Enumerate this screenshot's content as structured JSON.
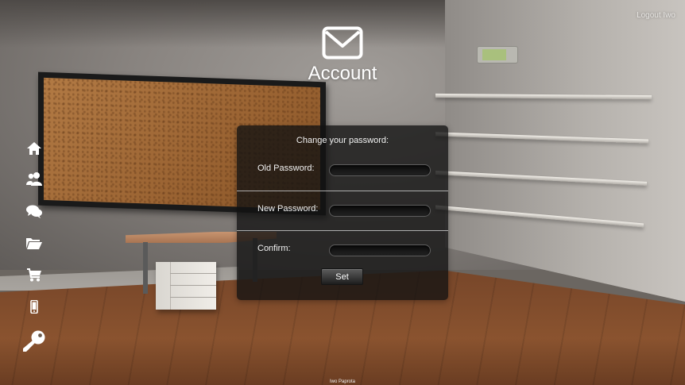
{
  "header": {
    "title": "Account",
    "icon": "envelope-icon",
    "logout_label": "Logout Iwo"
  },
  "sidebar": {
    "items": [
      {
        "name": "home",
        "icon": "home-icon"
      },
      {
        "name": "users",
        "icon": "users-icon"
      },
      {
        "name": "chat",
        "icon": "chat-bubbles-icon"
      },
      {
        "name": "folder",
        "icon": "folder-open-icon"
      },
      {
        "name": "cart",
        "icon": "shopping-cart-icon"
      },
      {
        "name": "mobile",
        "icon": "mobile-phone-icon"
      },
      {
        "name": "account",
        "icon": "key-icon"
      }
    ]
  },
  "panel": {
    "title": "Change your password:",
    "old_password_label": "Old Password:",
    "old_password_value": "",
    "new_password_label": "New Password:",
    "new_password_value": "",
    "confirm_label": "Confirm:",
    "confirm_value": "",
    "submit_label": "Set"
  },
  "footer": {
    "text": "Iwo Paprota"
  },
  "colors": {
    "panel_bg": "#121212",
    "text": "#ffffff",
    "wall": "#9a9692",
    "floor": "#7d4a2b"
  }
}
